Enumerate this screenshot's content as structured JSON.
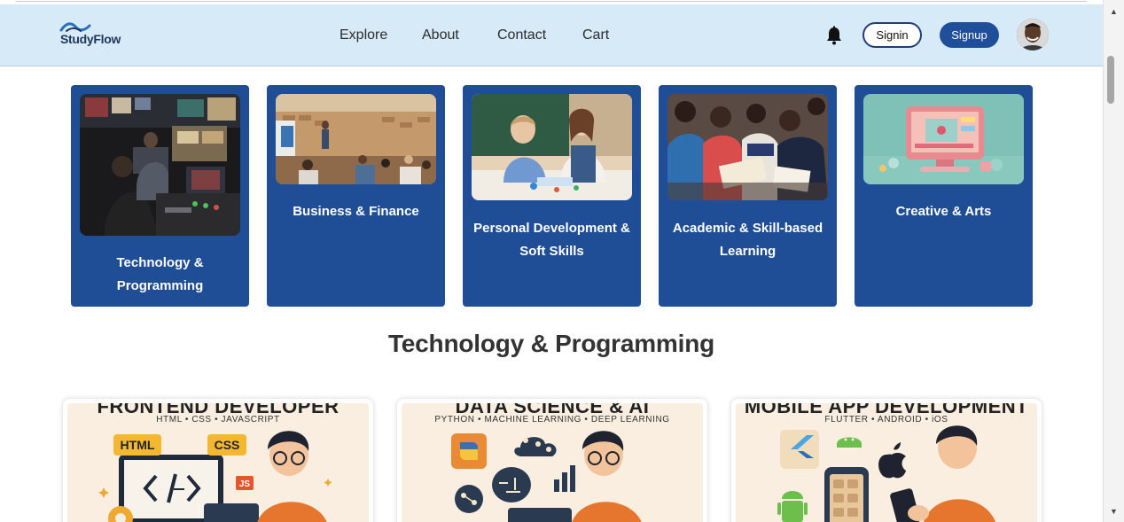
{
  "brand": {
    "name": "StudyFlow"
  },
  "nav": {
    "explore": "Explore",
    "about": "About",
    "contact": "Contact",
    "cart": "Cart"
  },
  "auth": {
    "signin": "Signin",
    "signup": "Signup"
  },
  "icons": {
    "notifications": "bell-icon",
    "profile": "avatar"
  },
  "categories": [
    {
      "label": "Technology & Programming"
    },
    {
      "label": "Business & Finance"
    },
    {
      "label": "Personal Development & Soft Skills"
    },
    {
      "label": "Academic & Skill-based Learning"
    },
    {
      "label": "Creative & Arts"
    }
  ],
  "section": {
    "title": "Technology & Programming"
  },
  "courses": [
    {
      "title": "FRONTEND DEVELOPER",
      "subtitle": "HTML • CSS • JAVASCRIPT",
      "badges": [
        "HTML",
        "CSS",
        "JS"
      ]
    },
    {
      "title": "DATA SCIENCE & AI",
      "subtitle": "PYTHON • MACHINE LEARNING • DEEP LEARNING"
    },
    {
      "title": "MOBILE APP DEVELOPMENT",
      "subtitle": "FLUTTER • ANDROID • iOS"
    }
  ],
  "colors": {
    "header_bg": "#d6eaf8",
    "card_bg": "#1f4e96",
    "primary": "#1f4e9a",
    "poster_bg": "#faeee0"
  }
}
